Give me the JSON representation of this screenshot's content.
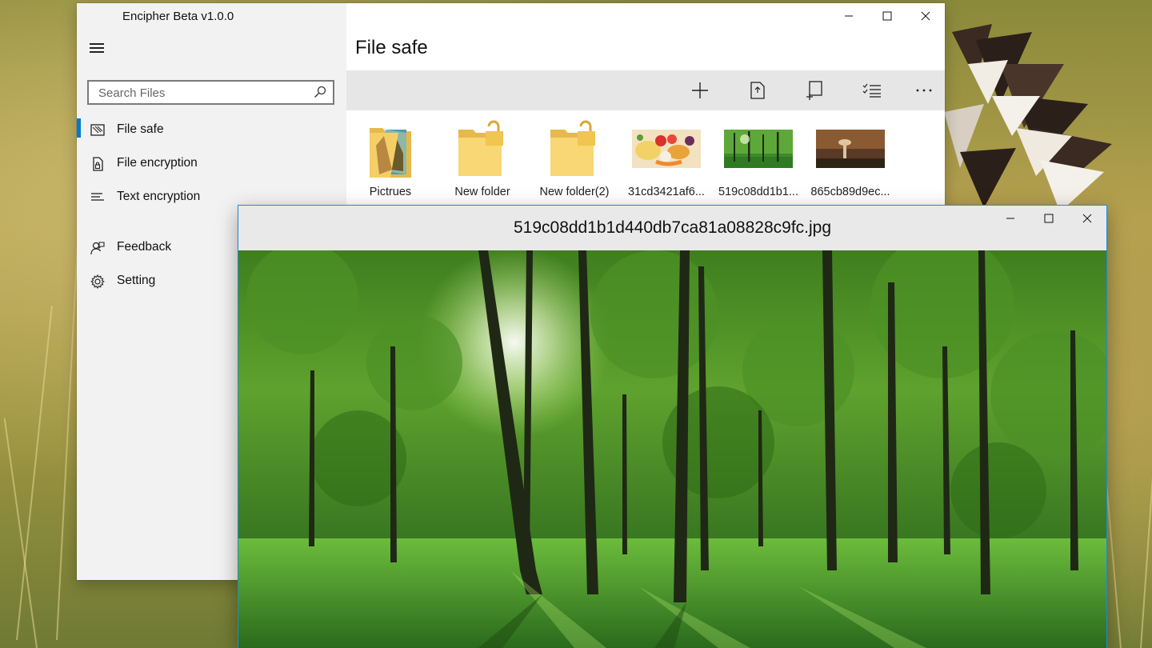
{
  "app": {
    "title": "Encipher  Beta v1.0.0",
    "search_placeholder": "Search Files",
    "nav": [
      {
        "label": "File safe",
        "icon": "file-safe-icon",
        "active": true
      },
      {
        "label": "File encryption",
        "icon": "file-lock-icon"
      },
      {
        "label": "Text encryption",
        "icon": "text-lines-icon"
      },
      {
        "label": "Feedback",
        "icon": "feedback-person-icon"
      },
      {
        "label": "Setting",
        "icon": "gear-icon"
      }
    ],
    "page_title": "File safe",
    "toolbar": [
      "add-icon",
      "export-file-icon",
      "import-file-icon",
      "select-list-icon",
      "more-icon"
    ],
    "files": [
      {
        "name": "Pictrues",
        "type": "folder-with-pictures"
      },
      {
        "name": "New folder",
        "type": "locked-folder"
      },
      {
        "name": "New folder(2)",
        "type": "locked-folder"
      },
      {
        "name": "31cd3421af6...",
        "type": "image-fruit"
      },
      {
        "name": "519c08dd1b1...",
        "type": "image-forest"
      },
      {
        "name": "865cb89d9ec...",
        "type": "image-mushroom"
      }
    ]
  },
  "viewer": {
    "title": "519c08dd1b1d440db7ca81a08828c9fc.jpg",
    "image": "forest-photo"
  },
  "colors": {
    "accent": "#0078d7",
    "sidebar_bg": "#f2f2f2",
    "toolbar_bg": "#e6e6e6",
    "viewer_border": "#1f8ad2"
  }
}
